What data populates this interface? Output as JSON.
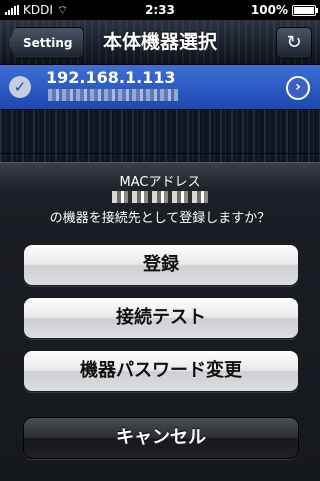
{
  "status_bar": {
    "carrier": "KDDI",
    "time": "2:33",
    "battery": "100%"
  },
  "navbar": {
    "back_label": "Setting",
    "title": "本体機器選択",
    "refresh_icon": "refresh-icon"
  },
  "list": {
    "selected_ip": "192.168.1.113"
  },
  "sheet": {
    "title": "MACアドレス",
    "message": "の機器を接続先として登録しますか？",
    "buttons": [
      "登録",
      "接続テスト",
      "機器パスワード変更"
    ],
    "cancel": "キャンセル"
  }
}
